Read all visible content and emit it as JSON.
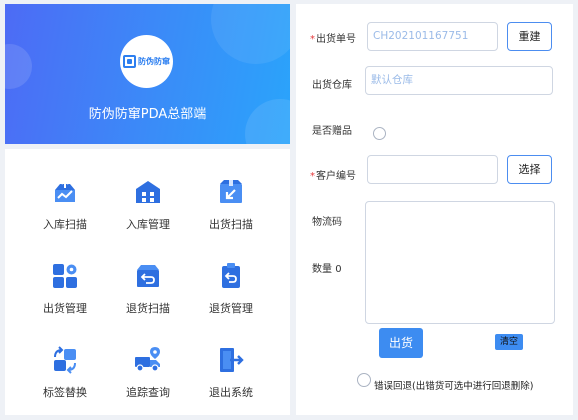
{
  "header": {
    "logo_text": "防伪防窜",
    "app_title": "防伪防窜PDA总部端"
  },
  "menu": {
    "items": [
      {
        "label": "入库扫描",
        "icon": "inbound-scan-icon"
      },
      {
        "label": "入库管理",
        "icon": "warehouse-icon"
      },
      {
        "label": "出货扫描",
        "icon": "outbound-scan-icon"
      },
      {
        "label": "出货管理",
        "icon": "grid-settings-icon"
      },
      {
        "label": "退货扫描",
        "icon": "return-box-icon"
      },
      {
        "label": "退货管理",
        "icon": "return-clipboard-icon"
      },
      {
        "label": "标签替换",
        "icon": "swap-arrows-icon"
      },
      {
        "label": "追踪查询",
        "icon": "truck-location-icon"
      },
      {
        "label": "退出系统",
        "icon": "exit-door-icon"
      }
    ]
  },
  "form": {
    "order_no": {
      "label": "出货单号",
      "value": "CH202101167751",
      "required": true
    },
    "reset_label": "重建",
    "warehouse": {
      "label": "出货仓库",
      "placeholder": "默认仓库"
    },
    "gift": {
      "label": "是否赠品"
    },
    "customer": {
      "label": "客户编号",
      "value": "",
      "required": true
    },
    "select_label": "选择",
    "logistics_label": "物流码",
    "quantity_label": "数量",
    "quantity_value": "0",
    "ship_label": "出货",
    "clear_label": "清空",
    "rollback_label": "错误回退(出错货可选中进行回退删除)"
  },
  "colors": {
    "primary": "#3d8cf1",
    "icon_blue": "#2e6fe0",
    "required": "#e4393c"
  }
}
